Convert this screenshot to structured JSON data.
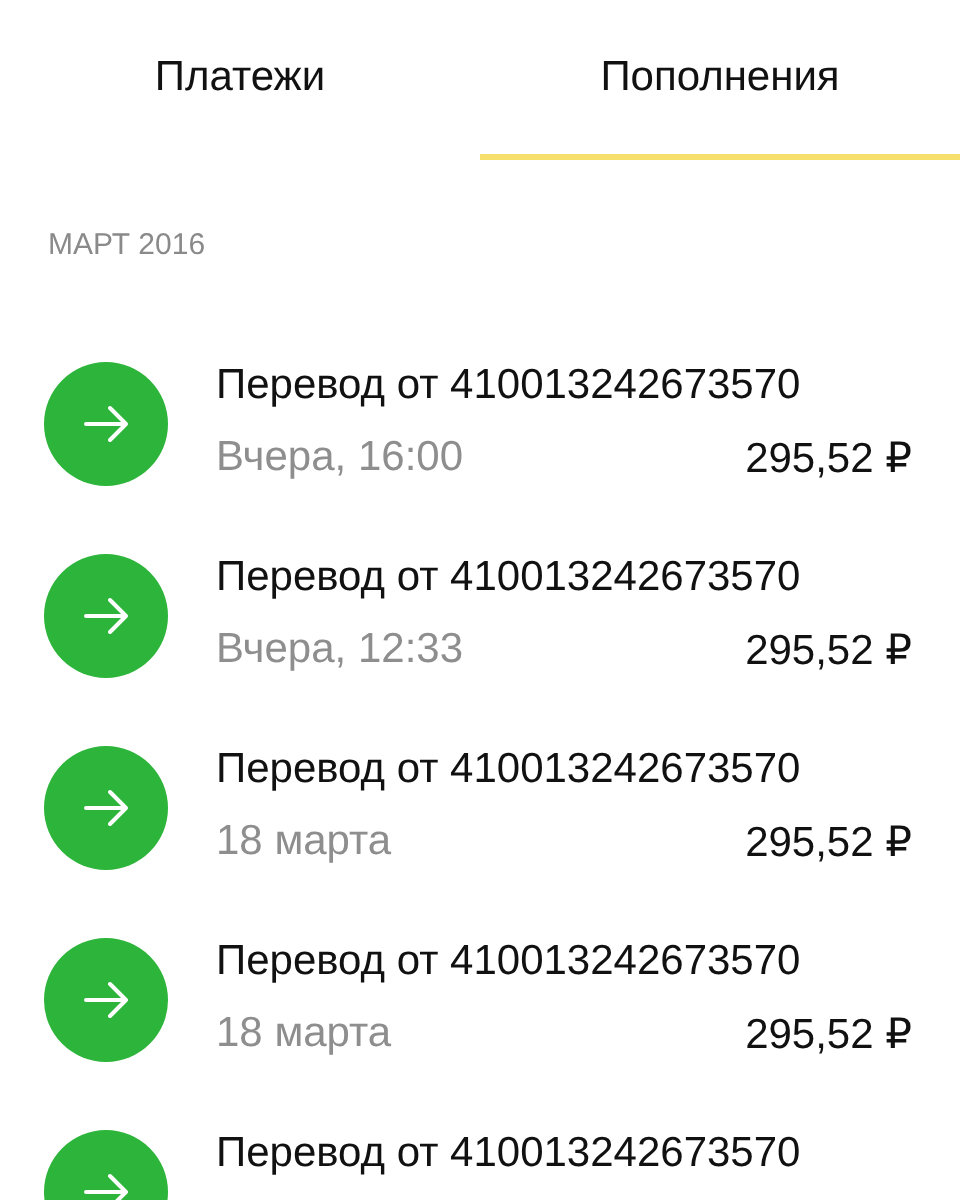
{
  "tabs": [
    {
      "label": "Платежи",
      "selected": false
    },
    {
      "label": "Пополнения",
      "selected": true
    }
  ],
  "section": "МАРТ 2016",
  "transactions": [
    {
      "title": "Перевод от 410013242673570",
      "date": "Вчера, 16:00",
      "amount": "295,52 ₽"
    },
    {
      "title": "Перевод от 410013242673570",
      "date": "Вчера, 12:33",
      "amount": "295,52 ₽"
    },
    {
      "title": "Перевод от 410013242673570",
      "date": "18 марта",
      "amount": "295,52 ₽"
    },
    {
      "title": "Перевод от 410013242673570",
      "date": "18 марта",
      "amount": "295,52 ₽"
    },
    {
      "title": "Перевод от 410013242673570"
    }
  ]
}
